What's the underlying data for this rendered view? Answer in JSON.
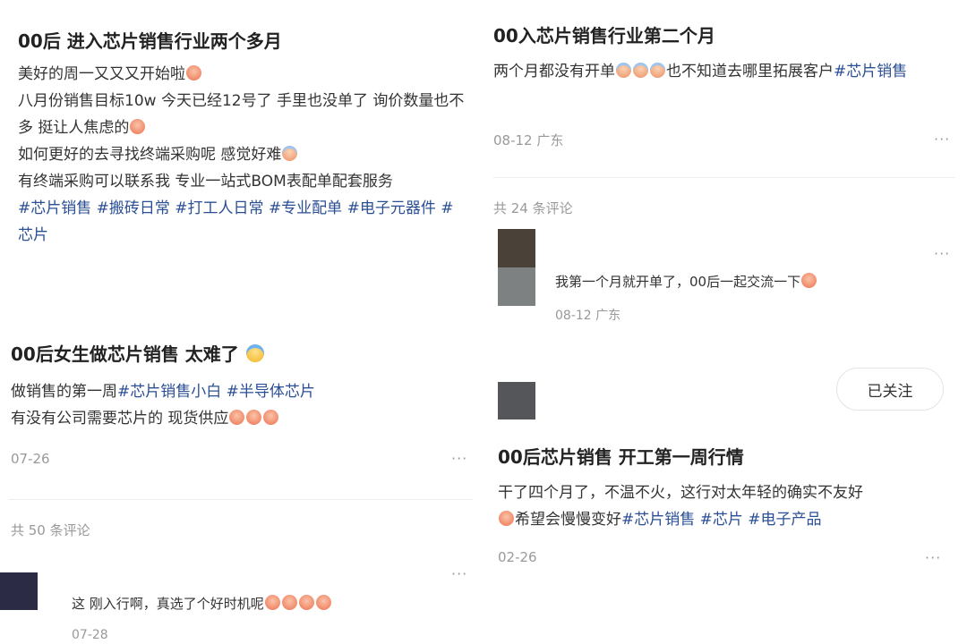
{
  "post1": {
    "title": "00后 进入芯片销售行业两个多月",
    "line1": "美好的周一又又又开始啦",
    "line2": "八月份销售目标10w 今天已经12号了 手里也没单了 询价数量也不多 挺让人焦虑的",
    "line3": "如何更好的去寻找终端采购呢 感觉好难",
    "line4": "有终端采购可以联系我 专业一站式BOM表配单配套服务",
    "tags": "#芯片销售 #搬砖日常 #打工人日常 #专业配单 #电子元器件 #芯片"
  },
  "post2": {
    "title": "00后女生做芯片销售 太难了",
    "line1_text": "做销售的第一周",
    "line1_tags": "#芯片销售小白 #半导体芯片",
    "line2": "有没有公司需要芯片的 现货供应",
    "date": "07-26",
    "more": "···",
    "comment_count": "共 50 条评论",
    "comment": {
      "text": "这 刚入行啊，真选了个好时机呢",
      "date": "07-28",
      "more": "···"
    }
  },
  "post3": {
    "title": "00入芯片销售行业第二个月",
    "line1_text": "两个月都没有开单",
    "line1_text2": "也不知道去哪里拓展客户",
    "line1_tag": "#芯片销售",
    "date_location": "08-12 广东",
    "more": "···",
    "comment_count": "共 24 条评论",
    "comment": {
      "text": "我第一个月就开单了，00后一起交流一下",
      "date_location": "08-12 广东",
      "more": "···"
    }
  },
  "post4": {
    "follow_label": "已关注",
    "title": "00后芯片销售 开工第一周行情",
    "line1": "干了四个月了，不温不火，这行对太年轻的确实不友好",
    "line2_text": "希望会慢慢变好",
    "line2_tags": "#芯片销售 #芯片 #电子产品",
    "date": "02-26",
    "more": "···"
  },
  "colors": {
    "tag_blue": "#2b4f94",
    "meta_gray": "#999999",
    "title_dark": "#222222"
  }
}
